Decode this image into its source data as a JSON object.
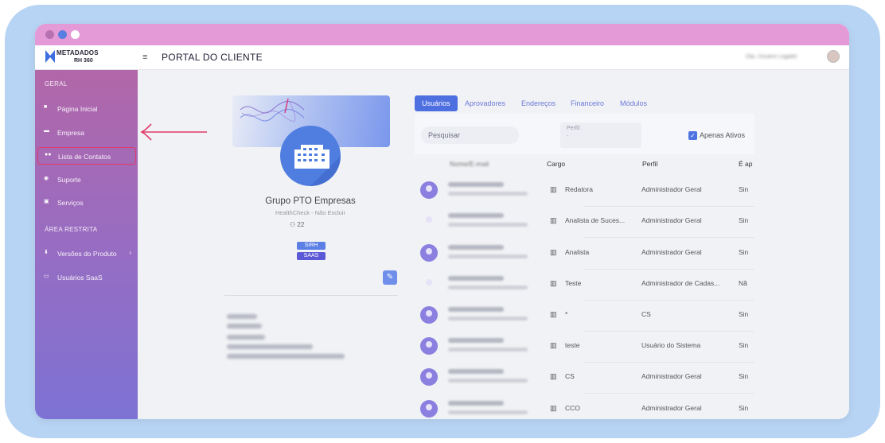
{
  "window": {
    "dots": [
      "#b672b0",
      "#5a7de0",
      "#ffffff"
    ]
  },
  "topbar": {
    "logo_text": "METADADOS",
    "logo_sub": "RH 360",
    "menu_icon": "≡",
    "title": "PORTAL DO CLIENTE",
    "user_name": "Ola, Usuario Logado"
  },
  "sidebar": {
    "section_geral": "GERAL",
    "section_restrita": "ÁREA RESTRITA",
    "items": [
      {
        "label": "Página Inicial",
        "icon": "home-icon"
      },
      {
        "label": "Empresa",
        "icon": "building-icon"
      },
      {
        "label": "Lista de Contatos",
        "icon": "contacts-icon"
      },
      {
        "label": "Suporte",
        "icon": "support-icon"
      },
      {
        "label": "Serviços",
        "icon": "services-icon"
      },
      {
        "label": "Versões do Produto",
        "icon": "download-icon"
      },
      {
        "label": "Usuários SaaS",
        "icon": "saas-icon"
      }
    ]
  },
  "company": {
    "name": "Grupo PTO Empresas",
    "subtitle": "HealthCheck - Não Excluir",
    "users_count": "22",
    "tags": [
      "SIRH",
      "SAAS"
    ]
  },
  "tabs": [
    "Usuários",
    "Aprovadores",
    "Endereços",
    "Financeiro",
    "Módulos"
  ],
  "filters": {
    "search_placeholder": "Pesquisar",
    "perfil_label": "Perfil:",
    "perfil_value": "-",
    "apenas_ativos": "Apenas Ativos"
  },
  "table": {
    "headers": {
      "nome": "Nome/E-mail",
      "cargo": "Cargo",
      "perfil": "Perfil",
      "admin": "É ap"
    },
    "rows": [
      {
        "cargo": "Redatora",
        "perfil": "Administrador Geral",
        "admin": "Sin"
      },
      {
        "cargo": "Analista de Suces...",
        "perfil": "Administrador Geral",
        "admin": "Sin"
      },
      {
        "cargo": "Analista",
        "perfil": "Administrador Geral",
        "admin": "Sin"
      },
      {
        "cargo": "Teste",
        "perfil": "Administrador de Cadas...",
        "admin": "Nã"
      },
      {
        "cargo": "*",
        "perfil": "CS",
        "admin": "Sin"
      },
      {
        "cargo": "teste",
        "perfil": "Usuário do Sistema",
        "admin": "Sin"
      },
      {
        "cargo": "CS",
        "perfil": "Administrador Geral",
        "admin": "Sin"
      },
      {
        "cargo": "CCO",
        "perfil": "Administrador Geral",
        "admin": "Sin"
      }
    ]
  }
}
